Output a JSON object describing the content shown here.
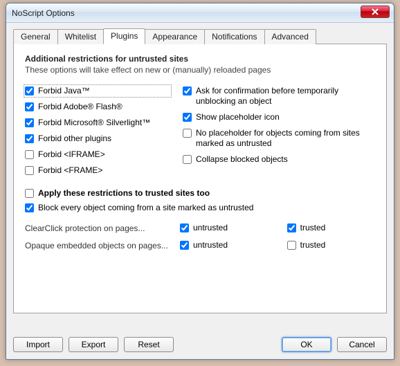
{
  "window": {
    "title": "NoScript Options"
  },
  "tabs": {
    "general": "General",
    "whitelist": "Whitelist",
    "plugins": "Plugins",
    "appearance": "Appearance",
    "notifications": "Notifications",
    "advanced": "Advanced",
    "active": "plugins"
  },
  "section": {
    "heading": "Additional restrictions for untrusted sites",
    "subtitle": "These options will take effect on new or (manually) reloaded pages"
  },
  "left": {
    "forbid_java": {
      "label": "Forbid Java™",
      "checked": true
    },
    "forbid_flash": {
      "label": "Forbid Adobe® Flash®",
      "checked": true
    },
    "forbid_silverlight": {
      "label": "Forbid Microsoft® Silverlight™",
      "checked": true
    },
    "forbid_other": {
      "label": "Forbid other plugins",
      "checked": true
    },
    "forbid_iframe": {
      "label": "Forbid <IFRAME>",
      "checked": false
    },
    "forbid_frame": {
      "label": "Forbid <FRAME>",
      "checked": false
    }
  },
  "right": {
    "ask_confirm": {
      "label": "Ask for confirmation before temporarily unblocking an object",
      "checked": true
    },
    "show_placeholder": {
      "label": "Show placeholder icon",
      "checked": true
    },
    "no_placeholder_untrusted": {
      "label": "No placeholder for objects coming from sites marked as untrusted",
      "checked": false
    },
    "collapse_blocked": {
      "label": "Collapse blocked objects",
      "checked": false
    }
  },
  "lower": {
    "apply_trusted": {
      "label": "Apply these restrictions to trusted sites too",
      "checked": false
    },
    "block_untrusted": {
      "label": "Block every object coming from a site marked as untrusted",
      "checked": true
    }
  },
  "grid": {
    "clearclick_label": "ClearClick protection on pages...",
    "clearclick_untrusted": {
      "label": "untrusted",
      "checked": true
    },
    "clearclick_trusted": {
      "label": "trusted",
      "checked": true
    },
    "opaque_label": "Opaque embedded objects on pages...",
    "opaque_untrusted": {
      "label": "untrusted",
      "checked": true
    },
    "opaque_trusted": {
      "label": "trusted",
      "checked": false
    }
  },
  "buttons": {
    "import": "Import",
    "export": "Export",
    "reset": "Reset",
    "ok": "OK",
    "cancel": "Cancel"
  }
}
